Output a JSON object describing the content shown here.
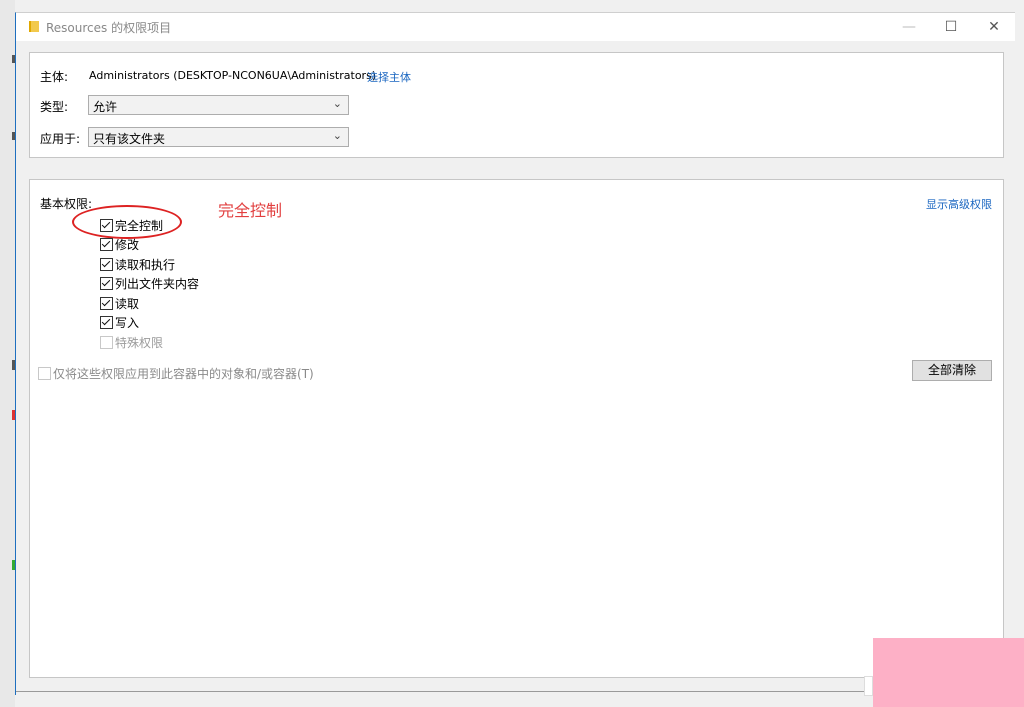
{
  "window": {
    "title": "Resources 的权限项目",
    "controls": {
      "minimize": "—",
      "maximize": "☐",
      "close": "✕"
    }
  },
  "principal": {
    "label": "主体:",
    "value": "Administrators (DESKTOP-NCON6UA\\Administrators)",
    "select_link": "选择主体"
  },
  "type": {
    "label": "类型:",
    "value": "允许"
  },
  "applies_to": {
    "label": "应用于:",
    "value": "只有该文件夹"
  },
  "basic_permissions": {
    "label": "基本权限:",
    "advanced_link": "显示高级权限",
    "items": [
      {
        "label": "完全控制",
        "checked": true,
        "enabled": true
      },
      {
        "label": "修改",
        "checked": true,
        "enabled": true
      },
      {
        "label": "读取和执行",
        "checked": true,
        "enabled": true
      },
      {
        "label": "列出文件夹内容",
        "checked": true,
        "enabled": true
      },
      {
        "label": "读取",
        "checked": true,
        "enabled": true
      },
      {
        "label": "写入",
        "checked": true,
        "enabled": true
      },
      {
        "label": "特殊权限",
        "checked": false,
        "enabled": false
      }
    ],
    "apply_only_container": {
      "label": "仅将这些权限应用到此容器中的对象和/或容器(T)",
      "checked": false,
      "enabled": false
    },
    "clear_all_button": "全部清除"
  },
  "annotation": {
    "text": "完全控制",
    "color": "#e24040"
  }
}
